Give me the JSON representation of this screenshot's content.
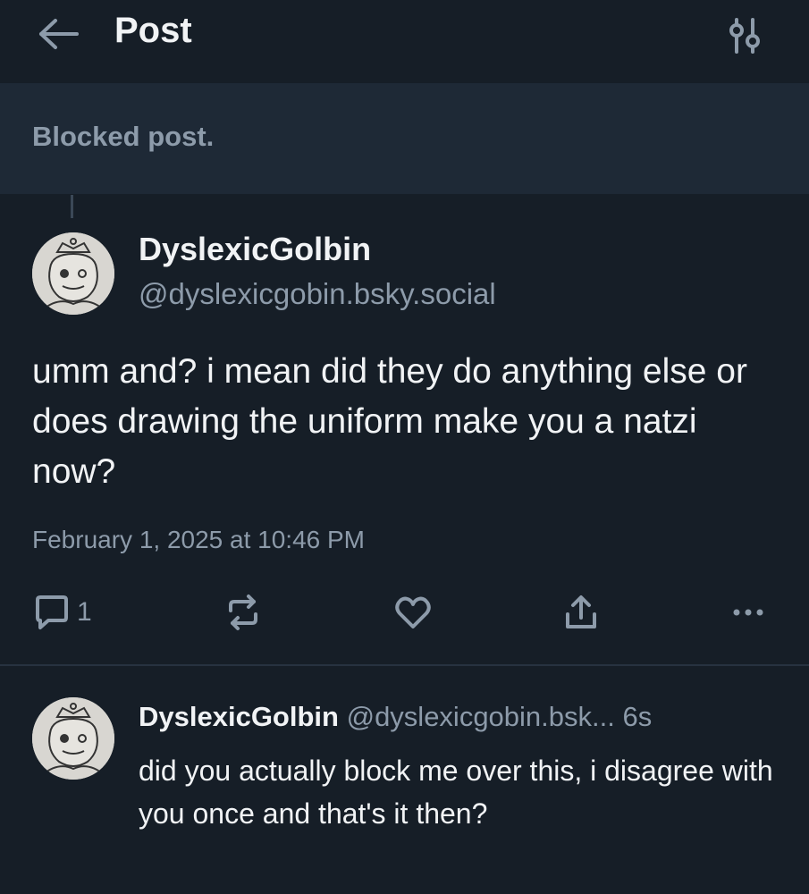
{
  "header": {
    "title": "Post",
    "back_icon": "arrow-left-icon",
    "filter_icon": "sliders-icon"
  },
  "blocked_post": {
    "label": "Blocked post."
  },
  "main_post": {
    "display_name": "DyslexicGolbin",
    "handle": "@dyslexicgobin.bsky.social",
    "text": "umm and? i mean did they do anything else or does drawing the uniform make you a natzi now?",
    "timestamp": "February 1, 2025 at 10:46 PM",
    "reply_count": "1",
    "icons": [
      "reply-icon",
      "repost-icon",
      "like-icon",
      "share-icon",
      "more-icon"
    ]
  },
  "reply": {
    "display_name": "DyslexicGolbin",
    "handle": "@dyslexicgobin.bsk...",
    "time": "6s",
    "text": "did you actually block me over this, i disagree with you once and that's it then?"
  },
  "colors": {
    "background": "#161e27",
    "blocked_background": "#1e2936",
    "primary_text": "#f1f3f5",
    "secondary_text": "#8d9baa",
    "divider": "#273240"
  }
}
